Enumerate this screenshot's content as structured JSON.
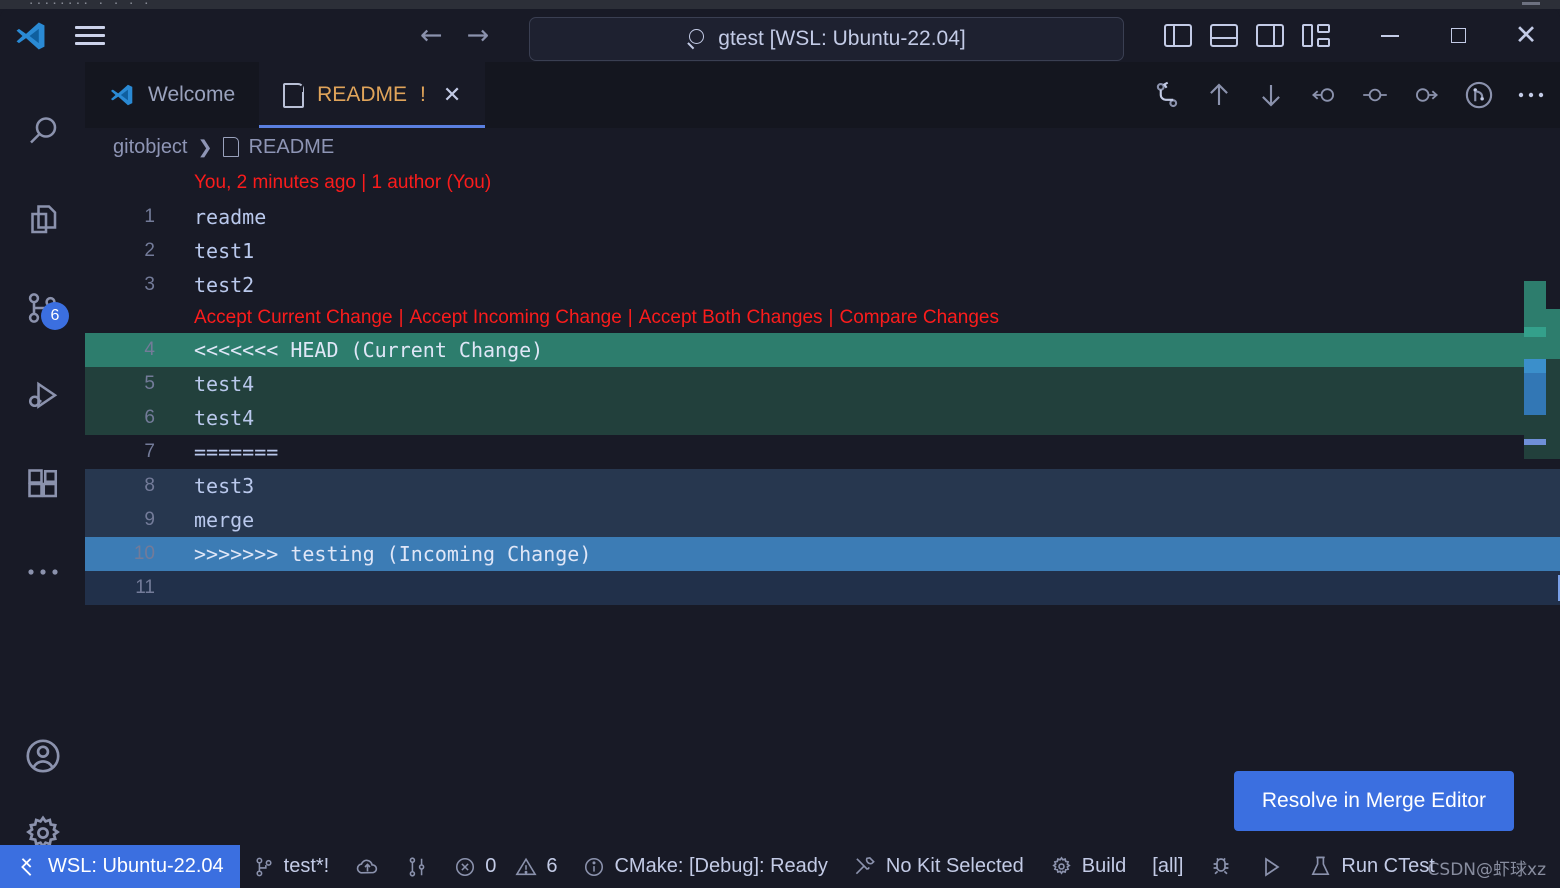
{
  "window": {
    "title": "gtest [WSL: Ubuntu-22.04]",
    "search_icon": "search-icon",
    "back_arrow": "←",
    "forward_arrow": "→",
    "minimize": "—",
    "maximize": "□",
    "close": "✕"
  },
  "activity_bar": {
    "items": [
      {
        "name": "search",
        "icon": "search-icon"
      },
      {
        "name": "explorer",
        "icon": "files-icon"
      },
      {
        "name": "source-control",
        "icon": "source-control-icon",
        "badge": "6"
      },
      {
        "name": "run-and-debug",
        "icon": "run-debug-icon"
      },
      {
        "name": "extensions",
        "icon": "extensions-icon"
      },
      {
        "name": "more",
        "icon": "ellipsis-icon"
      }
    ],
    "bottom": [
      {
        "name": "account",
        "icon": "account-icon"
      },
      {
        "name": "manage",
        "icon": "gear-icon"
      }
    ]
  },
  "tabs": [
    {
      "label": "Welcome",
      "icon": "vscode-icon",
      "active": false,
      "dirty": ""
    },
    {
      "label": "README",
      "icon": "file-icon",
      "active": true,
      "dirty": "!",
      "close": "✕"
    }
  ],
  "editor_actions": [
    {
      "name": "merge-changes-icon"
    },
    {
      "name": "arrow-up-icon"
    },
    {
      "name": "arrow-down-icon"
    },
    {
      "name": "previous-change-icon"
    },
    {
      "name": "current-change-icon"
    },
    {
      "name": "incoming-change-icon"
    },
    {
      "name": "open-merge-editor-icon"
    },
    {
      "name": "more-actions-icon"
    }
  ],
  "breadcrumb": {
    "folder": "gitobject",
    "separator": "❯",
    "file": "README"
  },
  "blame": "You, 2 minutes ago | 1 author (You)",
  "codelens": {
    "accept_current": "Accept Current Change",
    "accept_incoming": "Accept Incoming Change",
    "accept_both": "Accept Both Changes",
    "compare": "Compare Changes",
    "separator": "|"
  },
  "code_lines": [
    {
      "num": "1",
      "text": "readme",
      "style": "plain"
    },
    {
      "num": "2",
      "text": "test1",
      "style": "plain"
    },
    {
      "num": "3",
      "text": "test2",
      "style": "plain"
    },
    {
      "num": "4",
      "text": "<<<<<<< HEAD (Current Change)",
      "style": "current-head"
    },
    {
      "num": "5",
      "text": "test4",
      "style": "current-body"
    },
    {
      "num": "6",
      "text": "test4",
      "style": "current-body"
    },
    {
      "num": "7",
      "text": "=======",
      "style": "plain"
    },
    {
      "num": "8",
      "text": "test3",
      "style": "incoming-body"
    },
    {
      "num": "9",
      "text": "merge",
      "style": "incoming-body"
    },
    {
      "num": "10",
      "text": ">>>>>>> testing (Incoming Change)",
      "style": "incoming-head"
    },
    {
      "num": "11",
      "text": "",
      "style": "blank-selected"
    }
  ],
  "resolve_button": "Resolve in Merge Editor",
  "status_bar": {
    "remote": {
      "label": "WSL: Ubuntu-22.04",
      "icon": "remote-icon"
    },
    "items": [
      {
        "label": "test*!",
        "icon": "branch-icon"
      },
      {
        "label": "",
        "icon": "sync-cloud-icon"
      },
      {
        "label": "",
        "icon": "pull-request-icon"
      },
      {
        "label": "0",
        "icon": "error-icon"
      },
      {
        "label": "6",
        "icon": "warning-icon"
      },
      {
        "label": "CMake: [Debug]: Ready",
        "icon": "info-icon"
      },
      {
        "label": "No Kit Selected",
        "icon": "tools-icon"
      },
      {
        "label": "Build",
        "icon": "gear-icon"
      },
      {
        "label": "[all]",
        "icon": ""
      },
      {
        "label": "",
        "icon": "bug-icon"
      },
      {
        "label": "",
        "icon": "play-icon"
      },
      {
        "label": "Run CTest",
        "icon": "beaker-icon"
      }
    ]
  },
  "watermark": "CSDN@虾球xz",
  "colors": {
    "accent": "#3b6fe0",
    "current_change": "#2d7d6d",
    "current_change_body": "#22403c",
    "incoming_change": "#3c7cb5",
    "incoming_change_body": "#27374f",
    "conflict_text": "#fb1c1c",
    "dirty": "#e0a45a"
  }
}
